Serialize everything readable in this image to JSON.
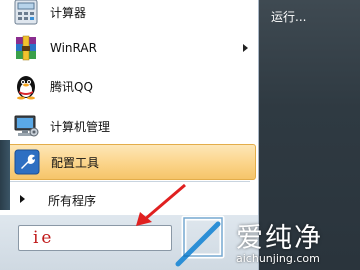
{
  "start_menu": {
    "programs": [
      {
        "label": "计算器",
        "icon": "calculator-icon"
      },
      {
        "label": "WinRAR",
        "icon": "winrar-icon",
        "has_submenu": true
      },
      {
        "label": "腾讯QQ",
        "icon": "qq-penguin-icon"
      },
      {
        "label": "计算机管理",
        "icon": "computer-management-icon"
      },
      {
        "label": "配置工具",
        "icon": "wrench-icon",
        "highlighted": true
      }
    ],
    "all_programs_label": "所有程序",
    "search": {
      "value": "ie"
    },
    "right_panel": {
      "run_label": "运行..."
    }
  },
  "watermark": {
    "text": "爱纯净",
    "url": "aichunjing.com"
  },
  "colors": {
    "highlight": "#fbd489",
    "annotation_red": "#e02020",
    "right_panel": "#2f3a42"
  }
}
